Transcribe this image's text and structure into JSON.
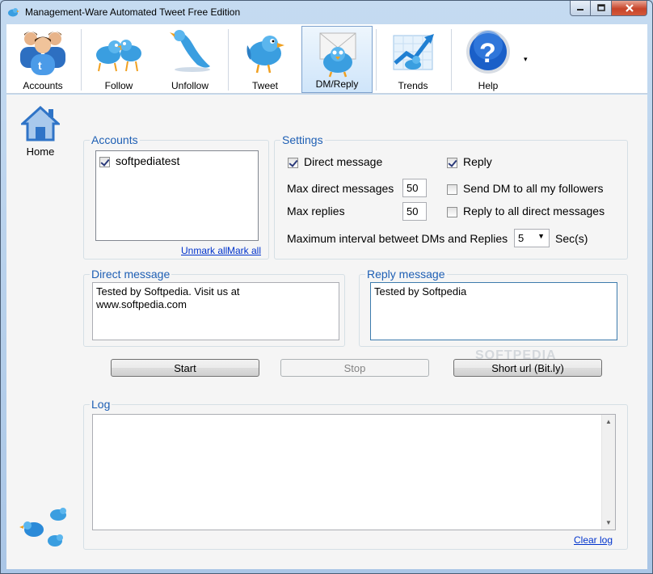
{
  "window": {
    "title": "Management-Ware Automated Tweet Free Edition"
  },
  "toolbar": {
    "items": [
      {
        "label": "Accounts",
        "icon": "accounts-icon"
      },
      {
        "label": "Follow",
        "icon": "follow-icon"
      },
      {
        "label": "Unfollow",
        "icon": "unfollow-icon"
      },
      {
        "label": "Tweet",
        "icon": "tweet-icon"
      },
      {
        "label": "DM/Reply",
        "icon": "dm-reply-icon",
        "selected": true
      },
      {
        "label": "Trends",
        "icon": "trends-icon"
      },
      {
        "label": "Help",
        "icon": "help-icon"
      }
    ],
    "more": "▾"
  },
  "sidebar": {
    "home_label": "Home"
  },
  "accounts": {
    "legend": "Accounts",
    "items": [
      {
        "name": "softpediatest",
        "checked": true
      }
    ],
    "unmark_all": "Unmark all",
    "mark_all": "Mark all"
  },
  "settings": {
    "legend": "Settings",
    "direct_message_label": "Direct message",
    "reply_label": "Reply",
    "max_dm_label": "Max direct messages",
    "max_dm_value": "50",
    "max_replies_label": "Max replies",
    "max_replies_value": "50",
    "send_dm_all_label": "Send DM to all my followers",
    "reply_all_dm_label": "Reply to all direct messages",
    "interval_label": "Maximum interval betweet DMs and Replies",
    "interval_value": "5",
    "interval_unit": "Sec(s)"
  },
  "direct_message": {
    "legend": "Direct message",
    "text": "Tested by Softpedia. Visit us at\nwww.softpedia.com"
  },
  "reply_message": {
    "legend": "Reply message",
    "text": "Tested by Softpedia"
  },
  "buttons": {
    "start": "Start",
    "stop": "Stop",
    "short_url": "Short url (Bit.ly)"
  },
  "log": {
    "legend": "Log",
    "clear": "Clear log",
    "up_arrow": "▲",
    "down_arrow": "▼"
  },
  "watermark": "SOFTPEDIA",
  "colors": {
    "legend_blue": "#1e5fb4",
    "link_blue": "#0033cc",
    "selected_bg": "#cfe5fa",
    "twitter_blue": "#3a9ee0"
  }
}
